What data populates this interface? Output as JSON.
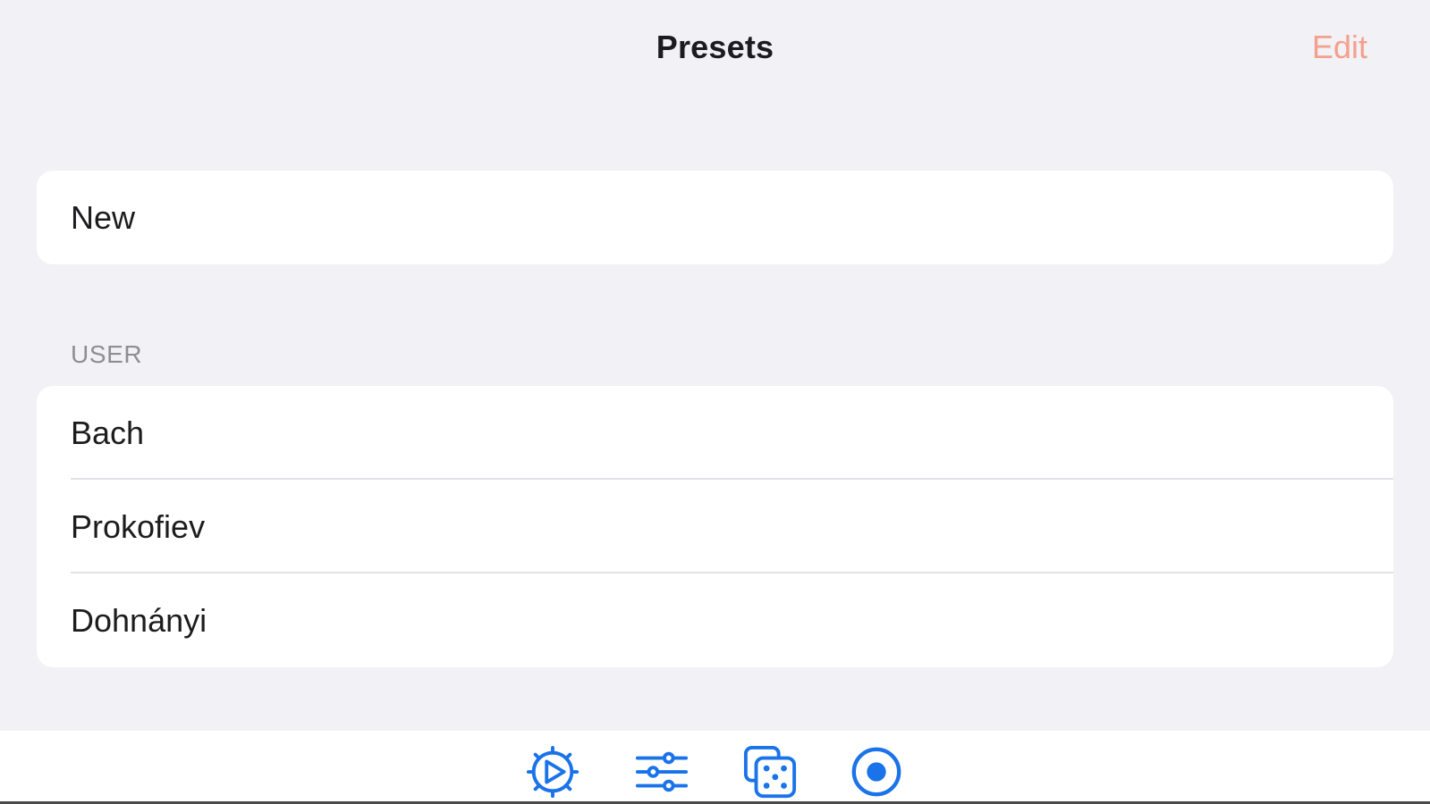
{
  "nav": {
    "title": "Presets",
    "edit_label": "Edit"
  },
  "new_section": {
    "label": "New"
  },
  "user_section": {
    "header": "USER",
    "items": [
      {
        "label": "Bach"
      },
      {
        "label": "Prokofiev"
      },
      {
        "label": "Dohnányi"
      }
    ]
  },
  "tab_bar": {
    "items": [
      {
        "icon": "gear-play-icon"
      },
      {
        "icon": "sliders-icon"
      },
      {
        "icon": "dice-icon"
      },
      {
        "icon": "record-icon"
      }
    ]
  },
  "colors": {
    "background": "#f1f1f6",
    "card": "#ffffff",
    "accent_edit": "#f4a08c",
    "tab_icon": "#1a73e8",
    "section_header": "#8e8e93"
  }
}
